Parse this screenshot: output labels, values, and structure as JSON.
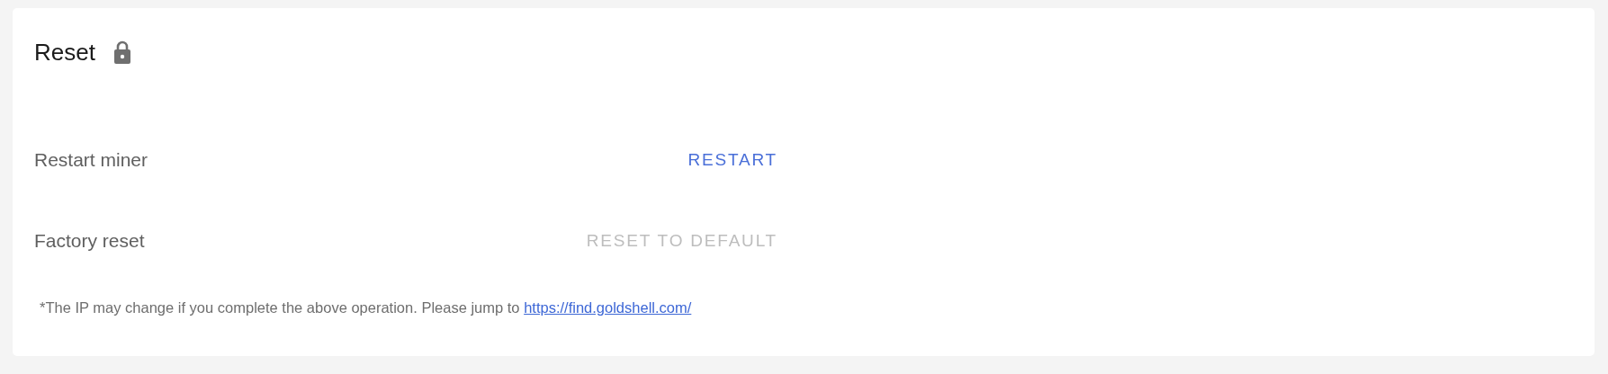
{
  "card": {
    "title": "Reset",
    "locked": true,
    "rows": [
      {
        "label": "Restart miner",
        "action": "RESTART",
        "disabled": false
      },
      {
        "label": "Factory reset",
        "action": "RESET TO DEFAULT",
        "disabled": true
      }
    ],
    "note": {
      "text": "*The IP may change if you complete the above operation. Please jump to",
      "link": "https://find.goldshell.com/"
    }
  }
}
